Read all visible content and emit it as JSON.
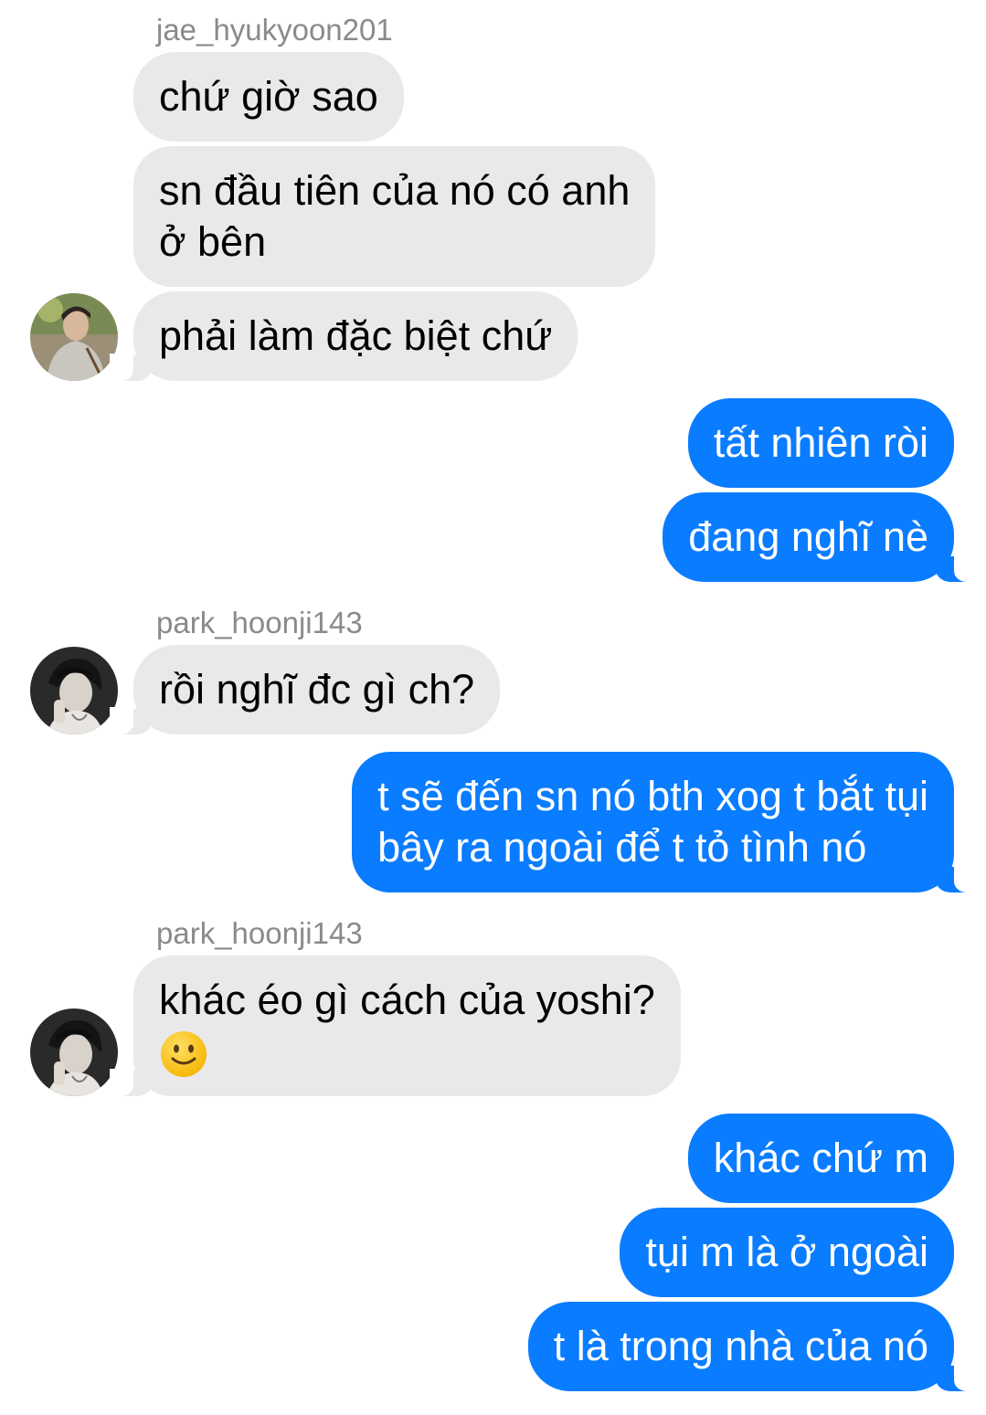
{
  "conversation": {
    "messages": [
      {
        "sender": "jae_hyukyoon201",
        "direction": "incoming",
        "text": "chứ giờ sao"
      },
      {
        "direction": "incoming",
        "line1": "sn đầu tiên của nó có anh",
        "line2": "ở bên"
      },
      {
        "direction": "incoming",
        "text": "phải làm đặc biệt chứ",
        "avatar": "avatar-jae"
      },
      {
        "direction": "outgoing",
        "text": "tất nhiên ròi"
      },
      {
        "direction": "outgoing",
        "text": "đang nghĩ nè"
      },
      {
        "sender": "park_hoonji143",
        "direction": "incoming",
        "text": "rồi nghĩ đc gì ch?",
        "avatar": "avatar-park"
      },
      {
        "direction": "outgoing",
        "line1": "t sẽ đến sn nó bth xog t bắt tụi",
        "line2": "bây ra ngoài để t tỏ tình nó"
      },
      {
        "sender": "park_hoonji143",
        "direction": "incoming",
        "line1": "khác éo gì cách của yoshi?",
        "emoji": "slightly-smiling-face-emoji",
        "avatar": "avatar-park"
      },
      {
        "direction": "outgoing",
        "text": "khác chứ m"
      },
      {
        "direction": "outgoing",
        "text": "tụi m là ở ngoài"
      },
      {
        "direction": "outgoing",
        "text": "t là trong nhà của nó"
      }
    ]
  },
  "colors": {
    "incoming_bubble": "#e9e9eb",
    "outgoing_bubble": "#0a7cff",
    "sender_label": "#8a8a8e"
  }
}
